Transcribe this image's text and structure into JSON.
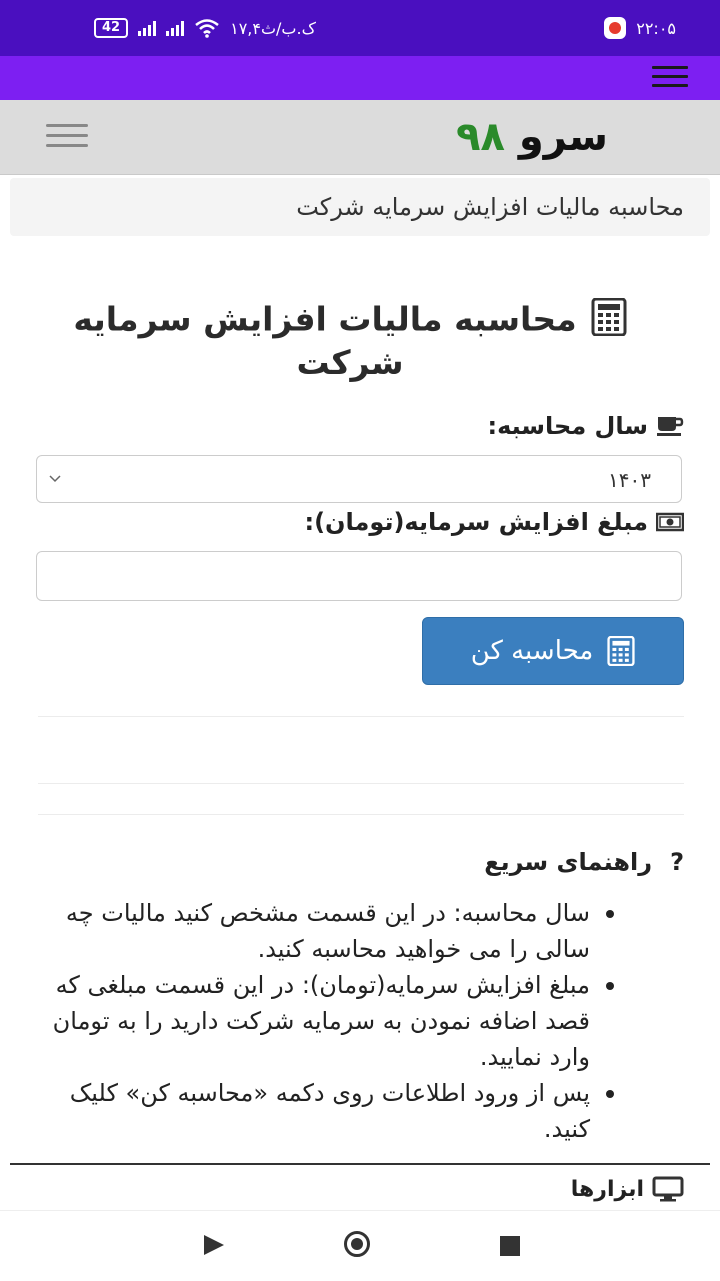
{
  "status_bar": {
    "battery": "42",
    "speed": "۱۷,۴ک.ب/ث",
    "time": "۲۲:۰۵"
  },
  "site": {
    "logo_word": "سرو",
    "logo_number": "۹۸"
  },
  "breadcrumb": "محاسبه مالیات افزایش سرمایه شرکت",
  "page_title": "محاسبه مالیات افزایش سرمایه شرکت",
  "form": {
    "year_label": "سال محاسبه:",
    "year_value": "۱۴۰۳",
    "amount_label": "مبلغ افزایش سرمایه(تومان):",
    "amount_value": "",
    "submit_label": "محاسبه کن"
  },
  "guide": {
    "title": "راهنمای سریع",
    "items": [
      "سال محاسبه: در این قسمت مشخص کنید مالیات چه سالی را می خواهید محاسبه کنید.",
      "مبلغ افزایش سرمایه(تومان): در این قسمت مبلغی که قصد اضافه نمودن به سرمایه شرکت دارید را به تومان وارد نمایید.",
      "پس از ورود اطلاعات روی دکمه «محاسبه کن» کلیک کنید."
    ]
  },
  "tools_title": "ابزارها",
  "colors": {
    "status_bar": "#4a0fbf",
    "app_bar": "#7d1ff2",
    "button": "#3b7fbf",
    "logo_green": "#2a8a2a"
  }
}
